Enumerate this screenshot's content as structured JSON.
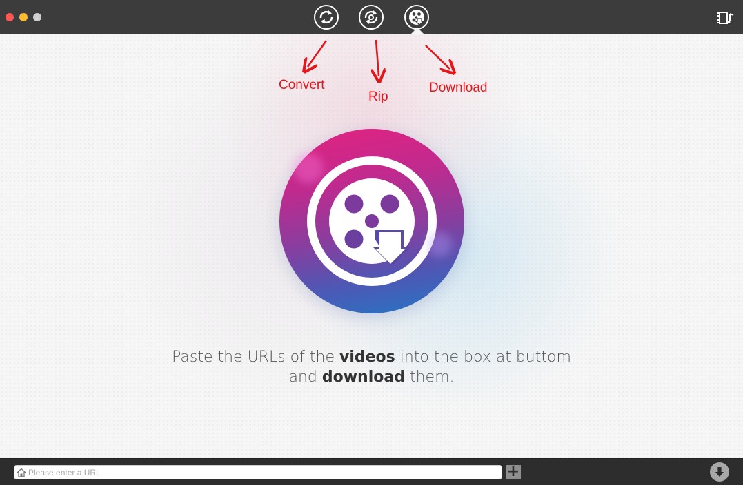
{
  "window": {
    "controls": [
      "close",
      "minimize",
      "zoom"
    ]
  },
  "toolbar": {
    "tabs": [
      {
        "id": "convert",
        "icon": "convert-icon",
        "active": false
      },
      {
        "id": "rip",
        "icon": "rip-icon",
        "active": false
      },
      {
        "id": "download",
        "icon": "download-icon",
        "active": true
      }
    ],
    "media_browser_icon": "film-music-icon"
  },
  "annotations": {
    "convert": "Convert",
    "rip": "Rip",
    "download": "Download",
    "color": "#e3161c"
  },
  "main": {
    "hero_icon": "film-reel-download-icon",
    "instruction": {
      "part1": "Paste the URLs of the ",
      "bold1": "videos",
      "part2": " into the box at buttom",
      "part3": "and ",
      "bold2": "download",
      "part4": " them."
    }
  },
  "bottombar": {
    "url_input": {
      "value": "",
      "placeholder": "Please enter a URL"
    },
    "add_label": "+",
    "download_all_icon": "download-arrow-icon"
  },
  "colors": {
    "titlebar": "#3c3c3c",
    "bottombar": "#2d2d2d",
    "hero_top": "#e32380",
    "hero_bottom": "#2477c4"
  }
}
